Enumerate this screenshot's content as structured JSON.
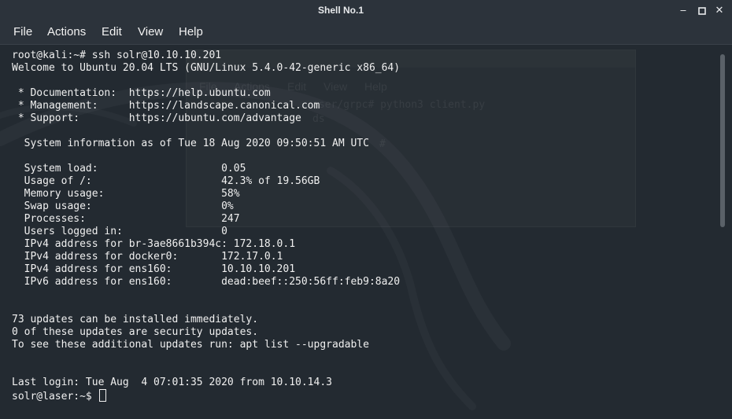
{
  "window": {
    "title": "Shell No.1",
    "controls": {
      "minimize": "minimize-icon",
      "maximize": "maximize-icon",
      "close": "close-icon"
    }
  },
  "menu": [
    "File",
    "Actions",
    "Edit",
    "View",
    "Help"
  ],
  "terminal": {
    "lines": [
      "root@kali:~# ssh solr@10.10.10.201",
      "Welcome to Ubuntu 20.04 LTS (GNU/Linux 5.4.0-42-generic x86_64)",
      "",
      " * Documentation:  https://help.ubuntu.com",
      " * Management:     https://landscape.canonical.com",
      " * Support:        https://ubuntu.com/advantage",
      "",
      "  System information as of Tue 18 Aug 2020 09:50:51 AM UTC",
      "",
      "  System load:                    0.05",
      "  Usage of /:                     42.3% of 19.56GB",
      "  Memory usage:                   58%",
      "  Swap usage:                     0%",
      "  Processes:                      247",
      "  Users logged in:                0",
      "  IPv4 address for br-3ae8661b394c: 172.18.0.1",
      "  IPv4 address for docker0:       172.17.0.1",
      "  IPv4 address for ens160:        10.10.10.201",
      "  IPv6 address for ens160:        dead:beef::250:56ff:feb9:8a20",
      "",
      "",
      "73 updates can be installed immediately.",
      "0 of these updates are security updates.",
      "To see these additional updates run: apt list --upgradable",
      "",
      "",
      "Last login: Tue Aug  4 07:01:35 2020 from 10.10.14.3"
    ],
    "prompt": "solr@laser:~$ "
  },
  "background_window": {
    "menu": [
      "File",
      "Actions",
      "Edit",
      "View",
      "Help"
    ],
    "lines": [
      "aser/grpc# python3 client.py",
      "ds",
      "# "
    ]
  },
  "colors": {
    "text": "#f0f0f0",
    "background": "#232a31",
    "titlebar": "#2c333b"
  }
}
